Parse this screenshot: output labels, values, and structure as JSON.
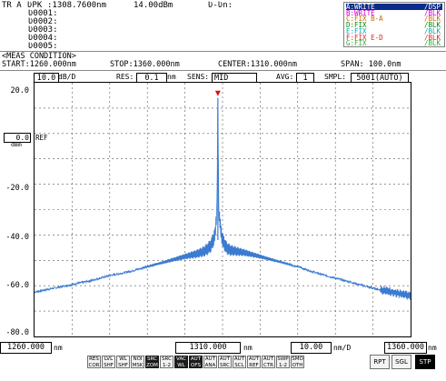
{
  "markers": {
    "row1_a": "TR A",
    "row1_b": "ƲPK",
    "row1_c": ":1308.7600nm",
    "row1_d": "14.00dBm",
    "row1_e": "Ʋ-Ʋn:",
    "rows": [
      "Ʋ0001:",
      "Ʋ0002:",
      "Ʋ0003:",
      "Ʋ0004:",
      "Ʋ0005:"
    ]
  },
  "traces": [
    {
      "name": "A:WRITE",
      "state": "/DSP",
      "color": "#0000cc",
      "highlight": true
    },
    {
      "name": "B:WRITE",
      "state": "/BLK",
      "color": "#cc00cc",
      "highlight": false
    },
    {
      "name": "C:FIX B-A",
      "state": "/BLK",
      "color": "#cc6600",
      "highlight": false
    },
    {
      "name": "D:FIX",
      "state": "/BLK",
      "color": "#008800",
      "highlight": false
    },
    {
      "name": "E:FIX",
      "state": "/BLK",
      "color": "#00aaaa",
      "highlight": false
    },
    {
      "name": "F:FIX E-D",
      "state": "/BLK",
      "color": "#dd2222",
      "highlight": false
    },
    {
      "name": "G:FIX",
      "state": "/BLK",
      "color": "#33aa33",
      "highlight": false
    }
  ],
  "meas": {
    "heading": "<MEAS CONDITION>",
    "start": "START:1260.000nm",
    "stop": "STOP:1360.000nm",
    "center": "CENTER:1310.000nm",
    "span": "SPAN: 100.0nm"
  },
  "settings": {
    "scale_value": "10.0",
    "scale_unit": "dB/D",
    "res_label": "RES:",
    "res_value": "0.1",
    "res_unit": "nm",
    "sens_label": "SENS:",
    "sens_value": "MID",
    "avg_label": "AVG:",
    "avg_value": "1",
    "smpl_label": "SMPL:",
    "smpl_value": "5001(AUTO)"
  },
  "ref": {
    "value": "0.0",
    "unit": "dBm",
    "label": "REF"
  },
  "y_ticks": [
    "20.0",
    "-20.0",
    "-40.0",
    "-60.0",
    "-80.0"
  ],
  "bottom": {
    "start_value": "1260.000",
    "start_unit": "nm",
    "center_value": "1310.000",
    "center_unit": "nm",
    "span_div_value": "10.00",
    "span_div_unit": "nm/D",
    "stop_value": "1360.000",
    "stop_unit": "nm"
  },
  "buttons": [
    {
      "l1": "RES",
      "l2": "COR",
      "dark": false
    },
    {
      "l1": "LVL",
      "l2": "SHF",
      "dark": false
    },
    {
      "l1": "WL",
      "l2": "SHF",
      "dark": false
    },
    {
      "l1": "NOI",
      "l2": "MSK",
      "dark": false
    },
    {
      "l1": "SRC",
      "l2": "ZOM",
      "dark": true
    },
    {
      "l1": "SRC",
      "l2": "1-2",
      "dark": false
    },
    {
      "l1": "VAC",
      "l2": "WL",
      "dark": true
    },
    {
      "l1": "AUT",
      "l2": "OFS",
      "dark": true
    },
    {
      "l1": "AUT",
      "l2": "ANA",
      "dark": false
    },
    {
      "l1": "AUT",
      "l2": "SRC",
      "dark": false
    },
    {
      "l1": "AUT",
      "l2": "SCL",
      "dark": false
    },
    {
      "l1": "AUT",
      "l2": "REF",
      "dark": false
    },
    {
      "l1": "AUT",
      "l2": "CTR",
      "dark": false
    },
    {
      "l1": "SWP",
      "l2": "1-2",
      "dark": false
    },
    {
      "l1": "SMO",
      "l2": "OTH",
      "dark": false
    }
  ],
  "sweep_buttons": [
    {
      "label": "RPT",
      "dark": false
    },
    {
      "label": "SGL",
      "dark": false
    },
    {
      "label": "STP",
      "dark": true
    }
  ],
  "chart_data": {
    "type": "line",
    "x_range": [
      1260.0,
      1360.0
    ],
    "ylim": [
      -80.0,
      20.0
    ],
    "grid": true,
    "peak": {
      "x": 1308.76,
      "y": 14.0
    },
    "series": [
      {
        "color": "#3b7bd0",
        "x": [
          1260,
          1265,
          1270,
          1275,
          1280,
          1285,
          1290,
          1295,
          1300,
          1303,
          1305,
          1306,
          1307,
          1308,
          1308.5,
          1308.76,
          1309,
          1309.5,
          1310,
          1311,
          1312,
          1314,
          1316,
          1320,
          1325,
          1330,
          1335,
          1340,
          1345,
          1350,
          1355,
          1360
        ],
        "y": [
          -62.5,
          -61.0,
          -59.5,
          -58.0,
          -56.0,
          -54.5,
          -52.5,
          -50.5,
          -48.5,
          -47.5,
          -46.5,
          -45.5,
          -44.0,
          -40.0,
          -30.0,
          14.0,
          -30.0,
          -38.0,
          -42.0,
          -45.0,
          -46.0,
          -46.5,
          -47.0,
          -48.5,
          -50.5,
          -52.5,
          -55.0,
          -57.0,
          -59.0,
          -61.0,
          -62.5,
          -64.0
        ]
      }
    ]
  }
}
